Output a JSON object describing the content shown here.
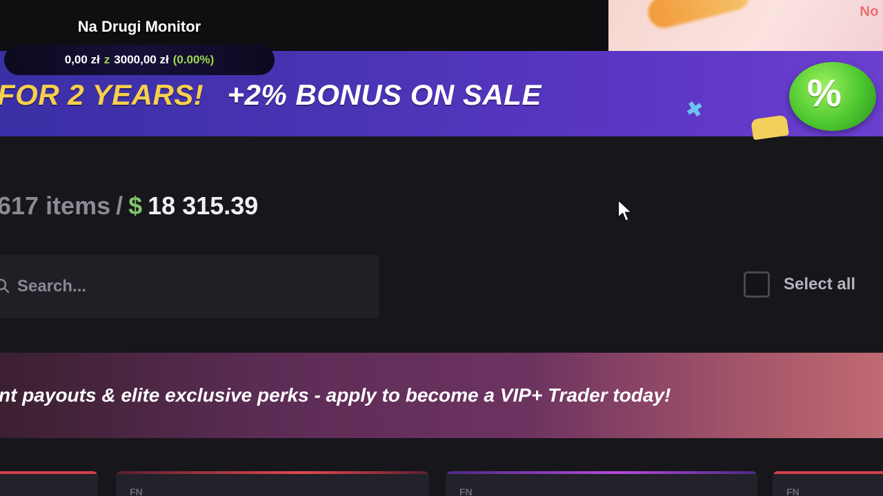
{
  "overlay": {
    "title": "Na Drugi Monitor",
    "current": "0,00 zł",
    "connector": "z",
    "goal": "3000,00 zł",
    "percent": "(0.00%)"
  },
  "popup": {
    "corner_text": "No"
  },
  "promo": {
    "years_text": "FOR 2 YEARS!",
    "bonus_text": "+2% BONUS ON SALE",
    "badge_symbol": "%"
  },
  "inventory": {
    "count_text": "617 items",
    "separator": "/",
    "currency": "$",
    "total_value": "18 315.39"
  },
  "search": {
    "placeholder": "Search..."
  },
  "select_all": {
    "label": "Select all",
    "checked": false
  },
  "vip": {
    "text": "nt payouts & elite exclusive perks - apply to become a VIP+ Trader today!"
  },
  "cards": [
    {
      "tag": "",
      "accent": "#d2404a"
    },
    {
      "tag": "FN",
      "accent": "#e8484f"
    },
    {
      "tag": "FN",
      "accent": "#b84ae0"
    },
    {
      "tag": "FN",
      "accent": "#d2404a"
    }
  ],
  "colors": {
    "background": "#17161b",
    "promo_years": "#f7cf4a",
    "money_green": "#7fc66a",
    "overlay_green": "#9dd94b"
  }
}
